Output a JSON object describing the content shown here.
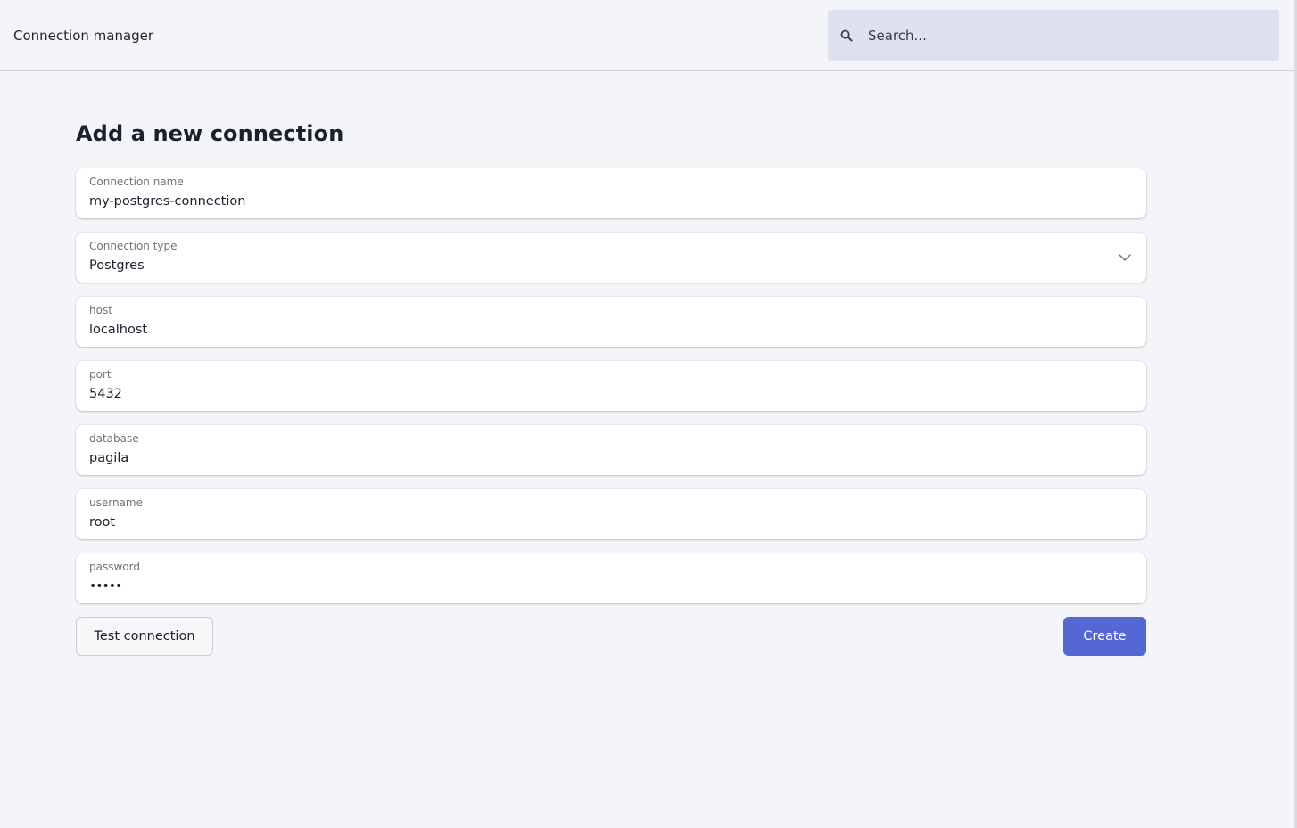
{
  "header": {
    "app_title": "Connection manager",
    "search": {
      "placeholder": "Search...",
      "icon": "search-icon"
    }
  },
  "main": {
    "heading": "Add a new connection",
    "fields": [
      {
        "label": "Connection name",
        "value": "my-postgres-connection"
      },
      {
        "label": "Connection type",
        "value": "Postgres",
        "control": "select",
        "icon": "chevron-down-icon"
      },
      {
        "label": "host",
        "value": "localhost"
      },
      {
        "label": "port",
        "value": "5432"
      },
      {
        "label": "database",
        "value": "pagila"
      },
      {
        "label": "username",
        "value": "root"
      },
      {
        "label": "password",
        "value": "•••••",
        "control": "password"
      }
    ],
    "actions": {
      "test_label": "Test connection",
      "create_label": "Create"
    }
  },
  "colors": {
    "background": "#f4f5f8",
    "search_background": "#dfe1ee",
    "primary_button": "#5467d3",
    "field_background": "#ffffff"
  }
}
